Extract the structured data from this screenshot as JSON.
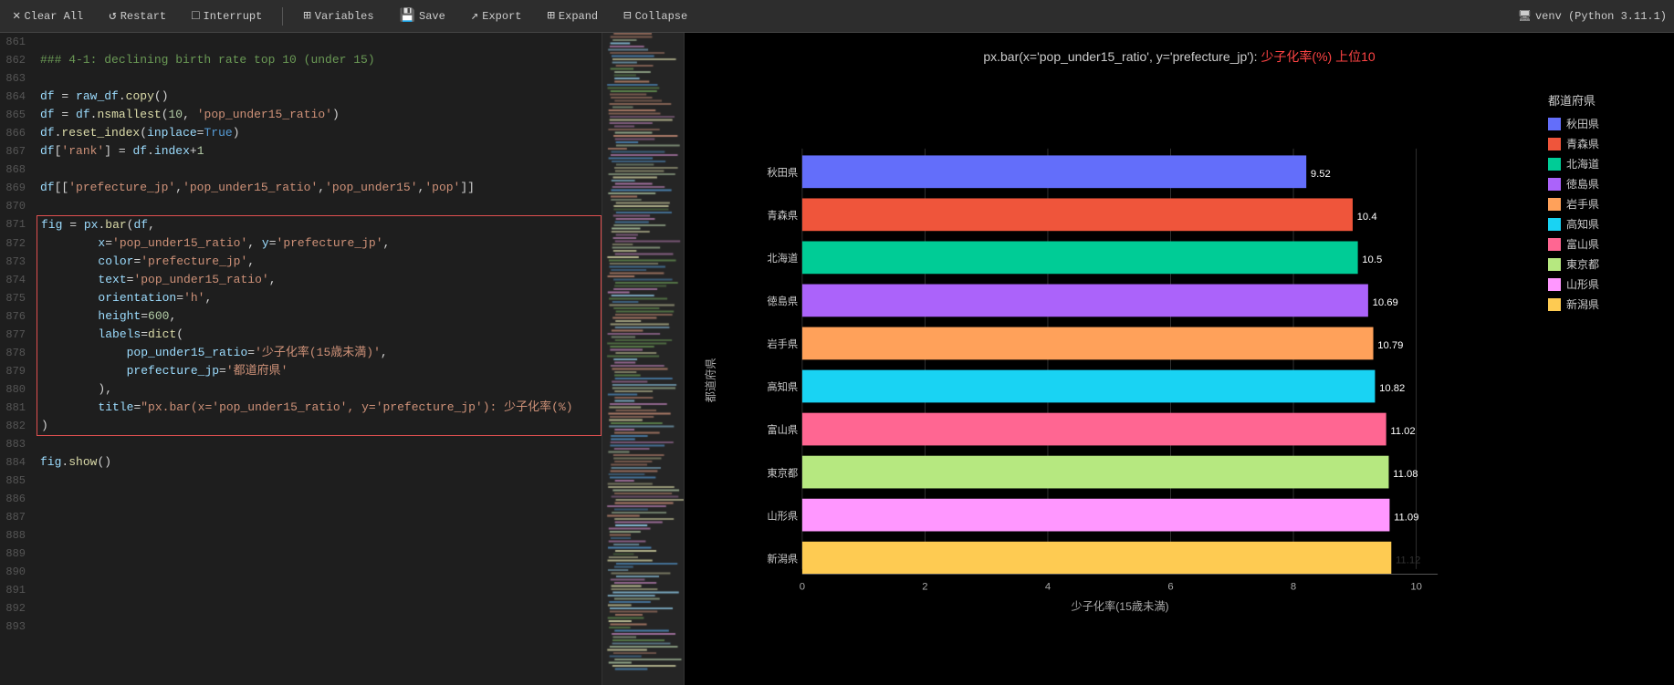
{
  "toolbar": {
    "clear_all": "Clear All",
    "restart": "Restart",
    "interrupt": "Interrupt",
    "variables": "Variables",
    "save": "Save",
    "export": "Export",
    "expand": "Expand",
    "collapse": "Collapse",
    "venv": "venv (Python 3.11.1)",
    "dots": "..."
  },
  "chart": {
    "title_prefix": "px.bar(x='pop_under15_ratio', y='prefecture_jp'): ",
    "title_suffix": "少子化率(%) 上位10",
    "x_label": "少子化率(15歳未満)",
    "y_label": "都道府県",
    "bars": [
      {
        "label": "秋田県",
        "value": 9.52,
        "color": "#636efa"
      },
      {
        "label": "青森県",
        "value": 10.4,
        "color": "#ef553b"
      },
      {
        "label": "北海道",
        "value": 10.5,
        "color": "#00cc96"
      },
      {
        "label": "徳島県",
        "value": 10.69,
        "color": "#ab63fa"
      },
      {
        "label": "岩手県",
        "value": 10.79,
        "color": "#ffa15a"
      },
      {
        "label": "高知県",
        "value": 10.82,
        "color": "#19d3f3"
      },
      {
        "label": "富山県",
        "value": 11.02,
        "color": "#ff6692"
      },
      {
        "label": "東京都",
        "value": 11.08,
        "color": "#b6e880"
      },
      {
        "label": "山形県",
        "value": 11.09,
        "color": "#ff97ff"
      },
      {
        "label": "新潟県",
        "value": 11.12,
        "color": "#fecb52"
      }
    ],
    "x_ticks": [
      "0",
      "2",
      "4",
      "6",
      "8",
      "10"
    ],
    "legend_title": "都道府県",
    "legend_items": [
      {
        "label": "秋田県",
        "color": "#636efa"
      },
      {
        "label": "青森県",
        "color": "#ef553b"
      },
      {
        "label": "北海道",
        "color": "#00cc96"
      },
      {
        "label": "徳島県",
        "color": "#ab63fa"
      },
      {
        "label": "岩手県",
        "color": "#ffa15a"
      },
      {
        "label": "高知県",
        "color": "#19d3f3"
      },
      {
        "label": "富山県",
        "color": "#ff6692"
      },
      {
        "label": "東京都",
        "color": "#b6e880"
      },
      {
        "label": "山形県",
        "color": "#ff97ff"
      },
      {
        "label": "新潟県",
        "color": "#fecb52"
      }
    ]
  },
  "code": {
    "lines": [
      {
        "num": 861,
        "text": ""
      },
      {
        "num": 862,
        "html": "<span class='cm'>### 4-1: declining birth rate top 10 (under 15)</span>"
      },
      {
        "num": 863,
        "text": ""
      },
      {
        "num": 864,
        "html": "<span class='var'>df</span> <span class='op'>=</span> <span class='var'>raw_df</span><span class='op'>.</span><span class='fn'>copy</span>()"
      },
      {
        "num": 865,
        "html": "<span class='var'>df</span> <span class='op'>=</span> <span class='var'>df</span><span class='op'>.</span><span class='fn'>nsmallest</span>(<span class='num'>10</span>, <span class='str'>'pop_under15_ratio'</span>)"
      },
      {
        "num": 866,
        "html": "<span class='var'>df</span><span class='op'>.</span><span class='fn'>reset_index</span>(<span class='var'>inplace</span><span class='op'>=</span><span class='kw'>True</span>)"
      },
      {
        "num": 867,
        "html": "<span class='var'>df</span>[<span class='str'>'rank'</span>] <span class='op'>=</span> <span class='var'>df</span><span class='op'>.</span><span class='var'>index</span><span class='op'>+</span><span class='num'>1</span>"
      },
      {
        "num": 868,
        "text": ""
      },
      {
        "num": 869,
        "html": "<span class='var'>df</span>[[<span class='str'>'prefecture_jp'</span>,<span class='str'>'pop_under15_ratio'</span>,<span class='str'>'pop_under15'</span>,<span class='str'>'pop'</span>]]"
      },
      {
        "num": 870,
        "text": ""
      },
      {
        "num": 871,
        "html": "<span class='var'>fig</span> <span class='op'>=</span> <span class='var'>px</span><span class='op'>.</span><span class='fn'>bar</span>(<span class='var'>df</span>,",
        "cell_start": true
      },
      {
        "num": 872,
        "html": "        <span class='var'>x</span><span class='op'>=</span><span class='str'>'pop_under15_ratio'</span>, <span class='var'>y</span><span class='op'>=</span><span class='str'>'prefecture_jp'</span>,",
        "cell_mid": true
      },
      {
        "num": 873,
        "html": "        <span class='var'>color</span><span class='op'>=</span><span class='str'>'prefecture_jp'</span>,",
        "cell_mid": true
      },
      {
        "num": 874,
        "html": "        <span class='var'>text</span><span class='op'>=</span><span class='str'>'pop_under15_ratio'</span>,",
        "cell_mid": true
      },
      {
        "num": 875,
        "html": "        <span class='var'>orientation</span><span class='op'>=</span><span class='str'>'h'</span>,",
        "cell_mid": true
      },
      {
        "num": 876,
        "html": "        <span class='var'>height</span><span class='op'>=</span><span class='num'>600</span>,",
        "cell_mid": true
      },
      {
        "num": 877,
        "html": "        <span class='var'>labels</span><span class='op'>=</span><span class='fn'>dict</span>(",
        "cell_mid": true
      },
      {
        "num": 878,
        "html": "            <span class='var'>pop_under15_ratio</span><span class='op'>=</span><span class='str'>'少子化率(15歳未満)'</span>,",
        "cell_mid": true
      },
      {
        "num": 879,
        "html": "            <span class='var'>prefecture_jp</span><span class='op'>=</span><span class='str'>'都道府県'</span>",
        "cell_mid": true
      },
      {
        "num": 880,
        "html": "        ),",
        "cell_mid": true
      },
      {
        "num": 881,
        "html": "        <span class='var'>title</span><span class='op'>=</span><span class='str'>\"px.bar(x='pop_under15_ratio', y='prefecture_jp'): 少子化率(%)</span>",
        "cell_mid": true
      },
      {
        "num": 882,
        "html": ")",
        "cell_mid": true
      },
      {
        "num": 883,
        "text": "",
        "cell_end": true
      },
      {
        "num": 884,
        "html": "<span class='var'>fig</span><span class='op'>.</span><span class='fn'>show</span>()"
      },
      {
        "num": 885,
        "text": ""
      },
      {
        "num": 886,
        "text": ""
      },
      {
        "num": 887,
        "text": ""
      },
      {
        "num": 888,
        "text": ""
      },
      {
        "num": 889,
        "text": ""
      },
      {
        "num": 890,
        "text": ""
      },
      {
        "num": 891,
        "text": ""
      },
      {
        "num": 892,
        "text": ""
      },
      {
        "num": 893,
        "text": ""
      }
    ]
  }
}
